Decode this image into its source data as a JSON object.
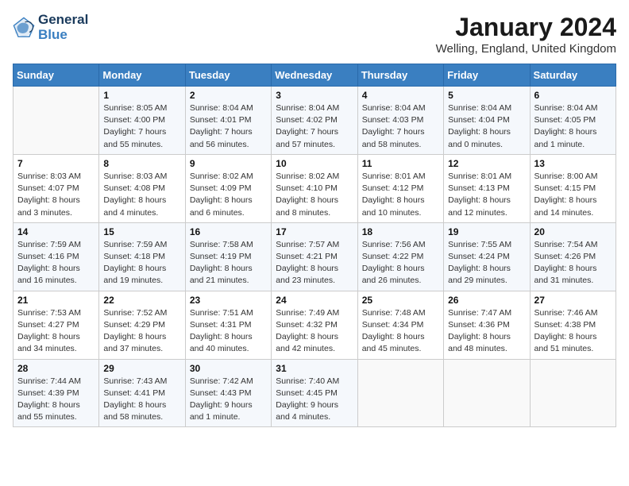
{
  "header": {
    "logo_line1": "General",
    "logo_line2": "Blue",
    "month_year": "January 2024",
    "location": "Welling, England, United Kingdom"
  },
  "days_of_week": [
    "Sunday",
    "Monday",
    "Tuesday",
    "Wednesday",
    "Thursday",
    "Friday",
    "Saturday"
  ],
  "weeks": [
    [
      {
        "day": "",
        "info": ""
      },
      {
        "day": "1",
        "info": "Sunrise: 8:05 AM\nSunset: 4:00 PM\nDaylight: 7 hours\nand 55 minutes."
      },
      {
        "day": "2",
        "info": "Sunrise: 8:04 AM\nSunset: 4:01 PM\nDaylight: 7 hours\nand 56 minutes."
      },
      {
        "day": "3",
        "info": "Sunrise: 8:04 AM\nSunset: 4:02 PM\nDaylight: 7 hours\nand 57 minutes."
      },
      {
        "day": "4",
        "info": "Sunrise: 8:04 AM\nSunset: 4:03 PM\nDaylight: 7 hours\nand 58 minutes."
      },
      {
        "day": "5",
        "info": "Sunrise: 8:04 AM\nSunset: 4:04 PM\nDaylight: 8 hours\nand 0 minutes."
      },
      {
        "day": "6",
        "info": "Sunrise: 8:04 AM\nSunset: 4:05 PM\nDaylight: 8 hours\nand 1 minute."
      }
    ],
    [
      {
        "day": "7",
        "info": "Sunrise: 8:03 AM\nSunset: 4:07 PM\nDaylight: 8 hours\nand 3 minutes."
      },
      {
        "day": "8",
        "info": "Sunrise: 8:03 AM\nSunset: 4:08 PM\nDaylight: 8 hours\nand 4 minutes."
      },
      {
        "day": "9",
        "info": "Sunrise: 8:02 AM\nSunset: 4:09 PM\nDaylight: 8 hours\nand 6 minutes."
      },
      {
        "day": "10",
        "info": "Sunrise: 8:02 AM\nSunset: 4:10 PM\nDaylight: 8 hours\nand 8 minutes."
      },
      {
        "day": "11",
        "info": "Sunrise: 8:01 AM\nSunset: 4:12 PM\nDaylight: 8 hours\nand 10 minutes."
      },
      {
        "day": "12",
        "info": "Sunrise: 8:01 AM\nSunset: 4:13 PM\nDaylight: 8 hours\nand 12 minutes."
      },
      {
        "day": "13",
        "info": "Sunrise: 8:00 AM\nSunset: 4:15 PM\nDaylight: 8 hours\nand 14 minutes."
      }
    ],
    [
      {
        "day": "14",
        "info": "Sunrise: 7:59 AM\nSunset: 4:16 PM\nDaylight: 8 hours\nand 16 minutes."
      },
      {
        "day": "15",
        "info": "Sunrise: 7:59 AM\nSunset: 4:18 PM\nDaylight: 8 hours\nand 19 minutes."
      },
      {
        "day": "16",
        "info": "Sunrise: 7:58 AM\nSunset: 4:19 PM\nDaylight: 8 hours\nand 21 minutes."
      },
      {
        "day": "17",
        "info": "Sunrise: 7:57 AM\nSunset: 4:21 PM\nDaylight: 8 hours\nand 23 minutes."
      },
      {
        "day": "18",
        "info": "Sunrise: 7:56 AM\nSunset: 4:22 PM\nDaylight: 8 hours\nand 26 minutes."
      },
      {
        "day": "19",
        "info": "Sunrise: 7:55 AM\nSunset: 4:24 PM\nDaylight: 8 hours\nand 29 minutes."
      },
      {
        "day": "20",
        "info": "Sunrise: 7:54 AM\nSunset: 4:26 PM\nDaylight: 8 hours\nand 31 minutes."
      }
    ],
    [
      {
        "day": "21",
        "info": "Sunrise: 7:53 AM\nSunset: 4:27 PM\nDaylight: 8 hours\nand 34 minutes."
      },
      {
        "day": "22",
        "info": "Sunrise: 7:52 AM\nSunset: 4:29 PM\nDaylight: 8 hours\nand 37 minutes."
      },
      {
        "day": "23",
        "info": "Sunrise: 7:51 AM\nSunset: 4:31 PM\nDaylight: 8 hours\nand 40 minutes."
      },
      {
        "day": "24",
        "info": "Sunrise: 7:49 AM\nSunset: 4:32 PM\nDaylight: 8 hours\nand 42 minutes."
      },
      {
        "day": "25",
        "info": "Sunrise: 7:48 AM\nSunset: 4:34 PM\nDaylight: 8 hours\nand 45 minutes."
      },
      {
        "day": "26",
        "info": "Sunrise: 7:47 AM\nSunset: 4:36 PM\nDaylight: 8 hours\nand 48 minutes."
      },
      {
        "day": "27",
        "info": "Sunrise: 7:46 AM\nSunset: 4:38 PM\nDaylight: 8 hours\nand 51 minutes."
      }
    ],
    [
      {
        "day": "28",
        "info": "Sunrise: 7:44 AM\nSunset: 4:39 PM\nDaylight: 8 hours\nand 55 minutes."
      },
      {
        "day": "29",
        "info": "Sunrise: 7:43 AM\nSunset: 4:41 PM\nDaylight: 8 hours\nand 58 minutes."
      },
      {
        "day": "30",
        "info": "Sunrise: 7:42 AM\nSunset: 4:43 PM\nDaylight: 9 hours\nand 1 minute."
      },
      {
        "day": "31",
        "info": "Sunrise: 7:40 AM\nSunset: 4:45 PM\nDaylight: 9 hours\nand 4 minutes."
      },
      {
        "day": "",
        "info": ""
      },
      {
        "day": "",
        "info": ""
      },
      {
        "day": "",
        "info": ""
      }
    ]
  ]
}
